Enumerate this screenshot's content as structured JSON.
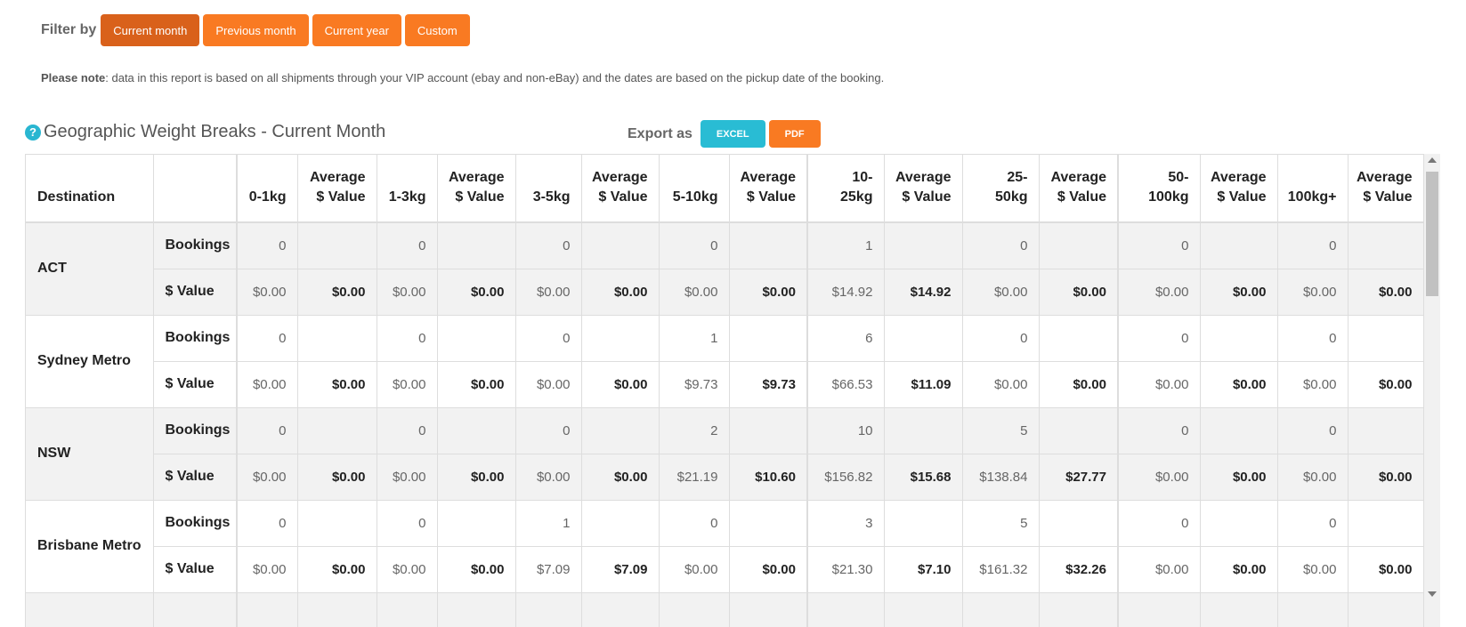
{
  "filter": {
    "label": "Filter by",
    "buttons": [
      "Current month",
      "Previous month",
      "Current year",
      "Custom"
    ]
  },
  "note": {
    "bold": "Please note",
    "text": ": data in this report is based on all shipments through your VIP account (ebay and non-eBay) and the dates are based on the pickup date of the booking."
  },
  "section": {
    "help_icon": "?",
    "title": "Geographic Weight Breaks - Current Month"
  },
  "export": {
    "label": "Export as",
    "excel": "EXCEL",
    "pdf": "PDF"
  },
  "colors": {
    "orange": "#f97a22",
    "orange_active": "#d9611b",
    "teal": "#29bcd4"
  },
  "table": {
    "headers": [
      "Destination",
      "",
      "0-1kg",
      "Average $ Value",
      "1-3kg",
      "Average $ Value",
      "3-5kg",
      "Average $ Value",
      "5-10kg",
      "Average $ Value",
      "10-25kg",
      "Average $ Value",
      "25-50kg",
      "Average $ Value",
      "50-100kg",
      "Average $ Value",
      "100kg+",
      "Average $ Value"
    ],
    "header_lines": [
      [
        "Destination"
      ],
      [
        ""
      ],
      [
        "0-1kg"
      ],
      [
        "Average",
        "$ Value"
      ],
      [
        "1-3kg"
      ],
      [
        "Average",
        "$ Value"
      ],
      [
        "3-5kg"
      ],
      [
        "Average",
        "$ Value"
      ],
      [
        "5-10kg"
      ],
      [
        "Average",
        "$ Value"
      ],
      [
        "10-",
        "25kg"
      ],
      [
        "Average",
        "$ Value"
      ],
      [
        "25-",
        "50kg"
      ],
      [
        "Average",
        "$ Value"
      ],
      [
        "50-",
        "100kg"
      ],
      [
        "Average",
        "$ Value"
      ],
      [
        "100kg+"
      ],
      [
        "Average",
        "$ Value"
      ]
    ],
    "bookings_label": "Bookings",
    "value_label": "$ Value",
    "rows": [
      {
        "region": "ACT",
        "bookings": [
          "0",
          "",
          "0",
          "",
          "0",
          "",
          "0",
          "",
          "1",
          "",
          "0",
          "",
          "0",
          "",
          "0",
          ""
        ],
        "values": [
          "$0.00",
          "$0.00",
          "$0.00",
          "$0.00",
          "$0.00",
          "$0.00",
          "$0.00",
          "$0.00",
          "$14.92",
          "$14.92",
          "$0.00",
          "$0.00",
          "$0.00",
          "$0.00",
          "$0.00",
          "$0.00"
        ]
      },
      {
        "region": "Sydney Metro",
        "bookings": [
          "0",
          "",
          "0",
          "",
          "0",
          "",
          "1",
          "",
          "6",
          "",
          "0",
          "",
          "0",
          "",
          "0",
          ""
        ],
        "values": [
          "$0.00",
          "$0.00",
          "$0.00",
          "$0.00",
          "$0.00",
          "$0.00",
          "$9.73",
          "$9.73",
          "$66.53",
          "$11.09",
          "$0.00",
          "$0.00",
          "$0.00",
          "$0.00",
          "$0.00",
          "$0.00"
        ]
      },
      {
        "region": "NSW",
        "bookings": [
          "0",
          "",
          "0",
          "",
          "0",
          "",
          "2",
          "",
          "10",
          "",
          "5",
          "",
          "0",
          "",
          "0",
          ""
        ],
        "values": [
          "$0.00",
          "$0.00",
          "$0.00",
          "$0.00",
          "$0.00",
          "$0.00",
          "$21.19",
          "$10.60",
          "$156.82",
          "$15.68",
          "$138.84",
          "$27.77",
          "$0.00",
          "$0.00",
          "$0.00",
          "$0.00"
        ]
      },
      {
        "region": "Brisbane Metro",
        "bookings": [
          "0",
          "",
          "0",
          "",
          "1",
          "",
          "0",
          "",
          "3",
          "",
          "5",
          "",
          "0",
          "",
          "0",
          ""
        ],
        "values": [
          "$0.00",
          "$0.00",
          "$0.00",
          "$0.00",
          "$7.09",
          "$7.09",
          "$0.00",
          "$0.00",
          "$21.30",
          "$7.10",
          "$161.32",
          "$32.26",
          "$0.00",
          "$0.00",
          "$0.00",
          "$0.00"
        ]
      }
    ]
  }
}
